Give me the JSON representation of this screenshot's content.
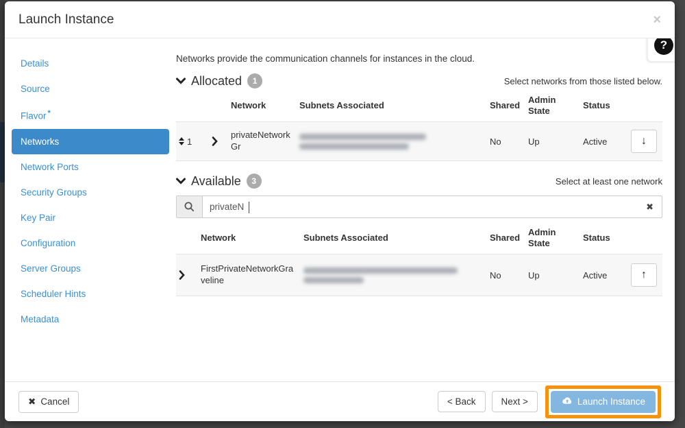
{
  "modal": {
    "title": "Launch Instance"
  },
  "icons": {
    "close": "×",
    "cancel_x": "✖",
    "clear_x": "✖",
    "help": "?",
    "deallocate_arrow": "↓",
    "allocate_arrow": "↑"
  },
  "sidebar": {
    "items": [
      {
        "label": "Details"
      },
      {
        "label": "Source"
      },
      {
        "label": "Flavor",
        "required_mark": "*"
      },
      {
        "label": "Networks",
        "active": true
      },
      {
        "label": "Network Ports"
      },
      {
        "label": "Security Groups"
      },
      {
        "label": "Key Pair"
      },
      {
        "label": "Configuration"
      },
      {
        "label": "Server Groups"
      },
      {
        "label": "Scheduler Hints"
      },
      {
        "label": "Metadata"
      }
    ]
  },
  "content": {
    "description": "Networks provide the communication channels for instances in the cloud.",
    "allocated": {
      "title": "Allocated",
      "count": "1",
      "hint": "Select networks from those listed below.",
      "columns": {
        "network": "Network",
        "subnets": "Subnets Associated",
        "shared": "Shared",
        "admin": "Admin State",
        "status": "Status"
      },
      "row": {
        "order": "1",
        "network": "privateNetworkGr",
        "subnets_masked": true,
        "shared": "No",
        "admin_state": "Up",
        "status": "Active"
      }
    },
    "available": {
      "title": "Available",
      "count": "3",
      "hint": "Select at least one network",
      "search_value": "privateN",
      "columns": {
        "network": "Network",
        "subnets": "Subnets Associated",
        "shared": "Shared",
        "admin": "Admin State",
        "status": "Status"
      },
      "row": {
        "network": "FirstPrivateNetworkGraveline",
        "subnets_masked": true,
        "shared": "No",
        "admin_state": "Up",
        "status": "Active"
      }
    }
  },
  "footer": {
    "cancel_label": "Cancel",
    "back_label": "< Back",
    "next_label": "Next >",
    "launch_label": "Launch Instance"
  },
  "colors": {
    "accent_blue": "#3a8fd4",
    "selected_nav_bg": "#3c8ac9",
    "launch_button_bg": "#84b7e0",
    "highlight_orange": "#f4930e",
    "badge_bg": "#ababab"
  }
}
